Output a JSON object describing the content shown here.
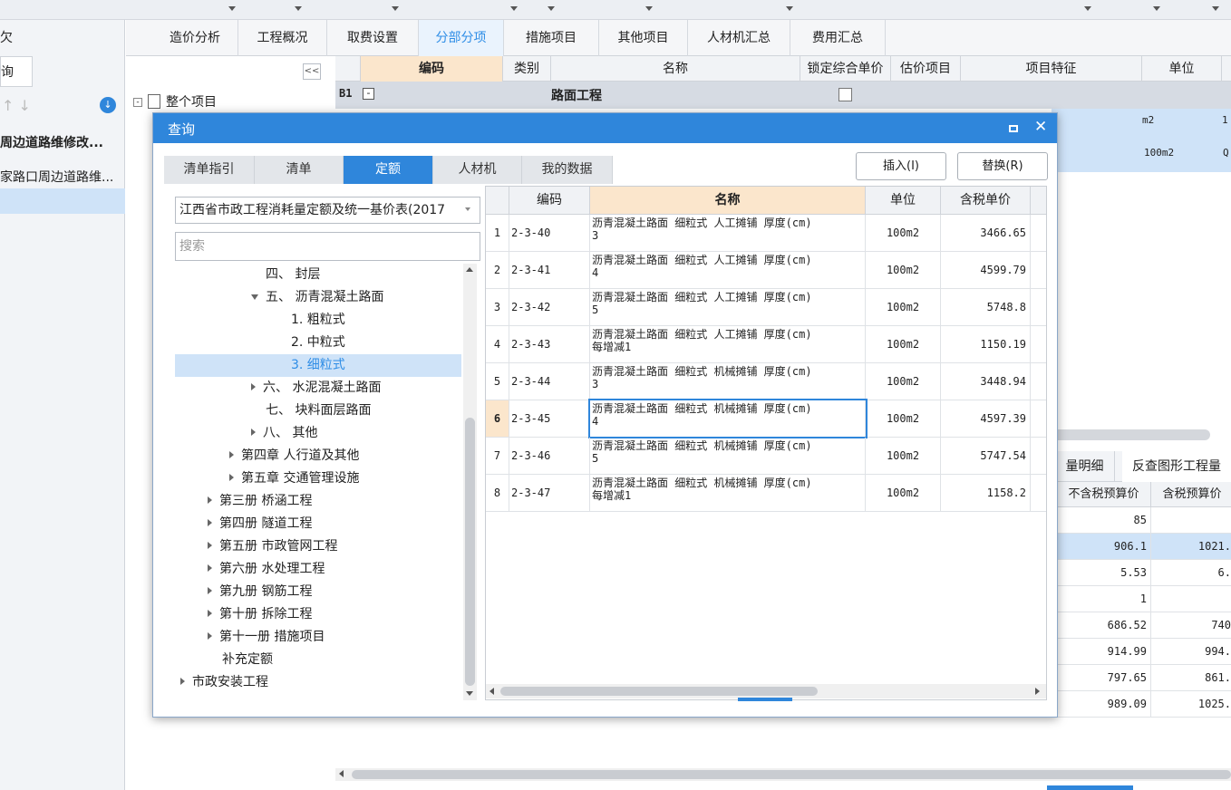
{
  "left_panel": {
    "title_fragment": "欠",
    "query_tab": "询",
    "items": [
      "周边道路维修改...",
      "家路口周边道路维..."
    ]
  },
  "nav_panel": {
    "collapse_label": "<<",
    "root_label": "整个项目"
  },
  "main_tabs": [
    "造价分析",
    "工程概况",
    "取费设置",
    "分部分项",
    "措施项目",
    "其他项目",
    "人材机汇总",
    "费用汇总"
  ],
  "active_main_tab": "分部分项",
  "grid": {
    "headers": [
      "编码",
      "类别",
      "名称",
      "锁定综合单价",
      "估价项目",
      "项目特征",
      "单位"
    ],
    "b1": {
      "code": "B1",
      "name": "路面工程"
    },
    "units": [
      "m2",
      "100m2"
    ],
    "extra_col": [
      "1",
      "Q"
    ]
  },
  "bottom_right": {
    "tabs": [
      "量明细",
      "反查图形工程量"
    ],
    "headers": [
      "不含税预算价",
      "含税预算价"
    ],
    "rows": [
      [
        "85",
        ""
      ],
      [
        "906.1",
        "1021."
      ],
      [
        "5.53",
        "6."
      ],
      [
        "1",
        ""
      ],
      [
        "686.52",
        "740"
      ],
      [
        "914.99",
        "994."
      ],
      [
        "797.65",
        "861."
      ],
      [
        "989.09",
        "1025."
      ]
    ]
  },
  "dialog": {
    "title": "查询",
    "tabs": [
      "清单指引",
      "清单",
      "定额",
      "人材机",
      "我的数据"
    ],
    "active_tab": "定额",
    "insert_button": "插入(I)",
    "replace_button": "替换(R)",
    "quota_select": "江西省市政工程消耗量定额及统一基价表(2017",
    "search_placeholder": "搜索",
    "tree": [
      {
        "label": "四、 封层",
        "indent": 100,
        "arrow": "none"
      },
      {
        "label": "五、 沥青混凝土路面",
        "indent": 84,
        "arrow": "down"
      },
      {
        "label": "1. 粗粒式",
        "indent": 128,
        "arrow": "none"
      },
      {
        "label": "2. 中粒式",
        "indent": 128,
        "arrow": "none"
      },
      {
        "label": "3. 细粒式",
        "indent": 128,
        "arrow": "none",
        "selected": true
      },
      {
        "label": "六、 水泥混凝土路面",
        "indent": 84,
        "arrow": "right"
      },
      {
        "label": "七、 块料面层路面",
        "indent": 100,
        "arrow": "none"
      },
      {
        "label": "八、 其他",
        "indent": 84,
        "arrow": "right"
      },
      {
        "label": "第四章 人行道及其他",
        "indent": 60,
        "arrow": "right"
      },
      {
        "label": "第五章 交通管理设施",
        "indent": 60,
        "arrow": "right"
      },
      {
        "label": "第三册 桥涵工程",
        "indent": 36,
        "arrow": "right"
      },
      {
        "label": "第四册 隧道工程",
        "indent": 36,
        "arrow": "right"
      },
      {
        "label": "第五册 市政管网工程",
        "indent": 36,
        "arrow": "right"
      },
      {
        "label": "第六册 水处理工程",
        "indent": 36,
        "arrow": "right"
      },
      {
        "label": "第九册 钢筋工程",
        "indent": 36,
        "arrow": "right"
      },
      {
        "label": "第十册 拆除工程",
        "indent": 36,
        "arrow": "right"
      },
      {
        "label": "第十一册 措施项目",
        "indent": 36,
        "arrow": "right"
      },
      {
        "label": "补充定额",
        "indent": 52,
        "arrow": "none"
      },
      {
        "label": "市政安装工程",
        "indent": 6,
        "arrow": "right"
      }
    ],
    "table_headers": [
      "编码",
      "名称",
      "单位",
      "含税单价"
    ],
    "rows": [
      {
        "no": "1",
        "code": "2-3-40",
        "name1": "沥青混凝土路面 细粒式 人工摊铺 厚度(cm)",
        "name2": "3",
        "unit": "100m2",
        "price": "3466.65"
      },
      {
        "no": "2",
        "code": "2-3-41",
        "name1": "沥青混凝土路面 细粒式 人工摊铺 厚度(cm)",
        "name2": "4",
        "unit": "100m2",
        "price": "4599.79"
      },
      {
        "no": "3",
        "code": "2-3-42",
        "name1": "沥青混凝土路面 细粒式 人工摊铺 厚度(cm)",
        "name2": "5",
        "unit": "100m2",
        "price": "5748.8"
      },
      {
        "no": "4",
        "code": "2-3-43",
        "name1": "沥青混凝土路面 细粒式 人工摊铺 厚度(cm)",
        "name2": "每增减1",
        "unit": "100m2",
        "price": "1150.19"
      },
      {
        "no": "5",
        "code": "2-3-44",
        "name1": "沥青混凝土路面 细粒式 机械摊铺 厚度(cm)",
        "name2": "3",
        "unit": "100m2",
        "price": "3448.94"
      },
      {
        "no": "6",
        "code": "2-3-45",
        "name1": "沥青混凝土路面 细粒式 机械摊铺 厚度(cm)",
        "name2": "4",
        "unit": "100m2",
        "price": "4597.39",
        "selected": true
      },
      {
        "no": "7",
        "code": "2-3-46",
        "name1": "沥青混凝土路面 细粒式 机械摊铺 厚度(cm)",
        "name2": "5",
        "unit": "100m2",
        "price": "5747.54"
      },
      {
        "no": "8",
        "code": "2-3-47",
        "name1": "沥青混凝土路面 细粒式 机械摊铺 厚度(cm)",
        "name2": "每增减1",
        "unit": "100m2",
        "price": "1158.2"
      }
    ]
  }
}
